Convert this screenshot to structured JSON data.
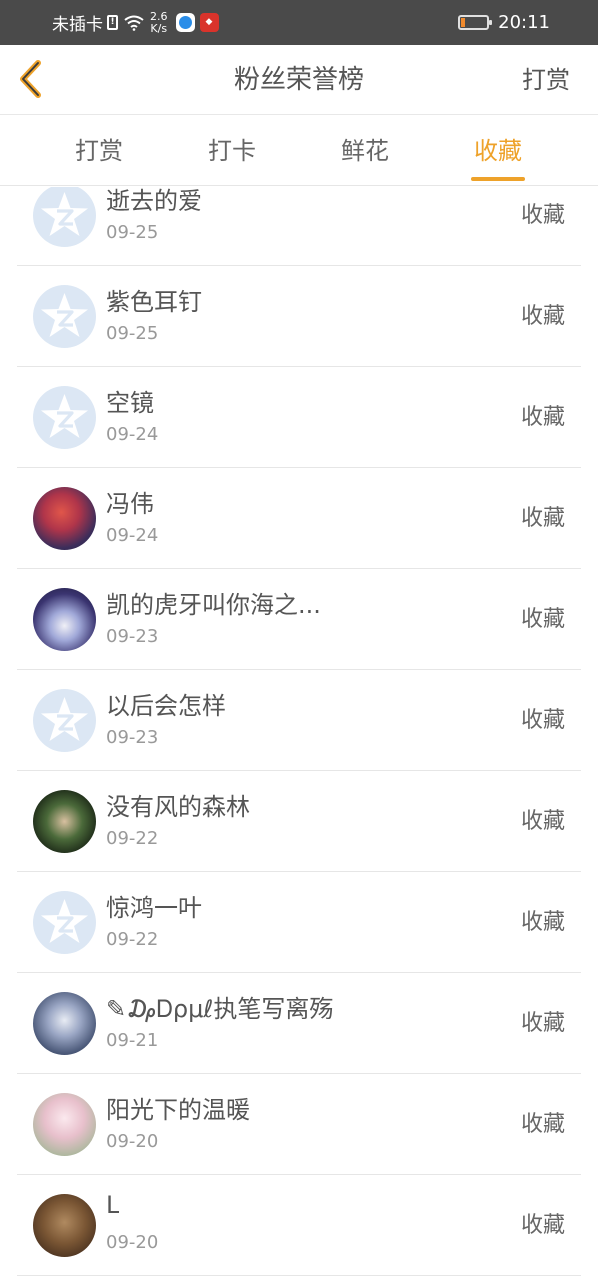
{
  "status_bar": {
    "carrier": "未插卡",
    "sim_label": "!",
    "speed_value": "2.6",
    "speed_unit": "K/s",
    "time": "20:11",
    "battery_level": 0.15
  },
  "nav": {
    "title": "粉丝荣誉榜",
    "action_label": "打赏"
  },
  "tabs": [
    {
      "label": "打赏"
    },
    {
      "label": "打卡"
    },
    {
      "label": "鲜花"
    },
    {
      "label": "收藏",
      "active": true
    }
  ],
  "list": [
    {
      "name": "逝去的爱",
      "date": "09-25",
      "action": "收藏",
      "avatar": "default"
    },
    {
      "name": "紫色耳钉",
      "date": "09-25",
      "action": "收藏",
      "avatar": "default"
    },
    {
      "name": "空镜",
      "date": "09-24",
      "action": "收藏",
      "avatar": "default"
    },
    {
      "name": "冯伟",
      "date": "09-24",
      "action": "收藏",
      "avatar": "photo"
    },
    {
      "name": "凯的虎牙叫你海之...",
      "date": "09-23",
      "action": "收藏",
      "avatar": "photo"
    },
    {
      "name": "以后会怎样",
      "date": "09-23",
      "action": "收藏",
      "avatar": "default"
    },
    {
      "name": "没有风的森林",
      "date": "09-22",
      "action": "收藏",
      "avatar": "photo"
    },
    {
      "name": "惊鸿一叶",
      "date": "09-22",
      "action": "收藏",
      "avatar": "default"
    },
    {
      "name": "✎₯Ꭰρμℓ执笔写离殇",
      "date": "09-21",
      "action": "收藏",
      "avatar": "photo"
    },
    {
      "name": "阳光下的温暖",
      "date": "09-20",
      "action": "收藏",
      "avatar": "photo"
    },
    {
      "name": "L",
      "date": "09-20",
      "action": "收藏",
      "avatar": "photo"
    }
  ],
  "colors": {
    "accent": "#eea22a",
    "status_bar": "#4a4a4a",
    "default_avatar": "#dce7f4"
  }
}
